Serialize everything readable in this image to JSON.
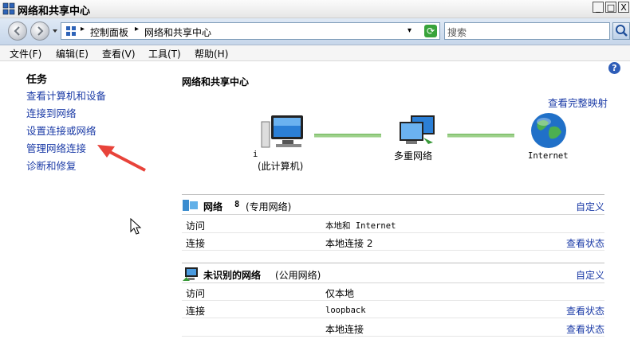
{
  "window": {
    "title": "网络和共享中心",
    "controls": {
      "minimize": "_",
      "maximize": "□",
      "close": "X"
    }
  },
  "address_bar": {
    "dropdown_arrow": "▾",
    "breadcrumbs": [
      "控制面板",
      "网络和共享中心"
    ],
    "search_placeholder": "搜索"
  },
  "menu": [
    "文件(F)",
    "编辑(E)",
    "查看(V)",
    "工具(T)",
    "帮助(H)"
  ],
  "help_symbol": "?",
  "tasks": {
    "title": "任务",
    "items": [
      "查看计算机和设备",
      "连接到网络",
      "设置连接或网络",
      "管理网络连接",
      "诊断和修复"
    ]
  },
  "main": {
    "title": "网络和共享中心",
    "full_map_link": "查看完整映射",
    "map": {
      "computer_label": "i",
      "computer_sublabel": "(此计算机)",
      "middle_label": "多重网络",
      "internet_label": "Internet"
    },
    "networks": [
      {
        "name": "网络",
        "name_suffix": "8",
        "type": "(专用网络)",
        "customize": "自定义",
        "rows": [
          {
            "label": "访问",
            "value": "本地和 Internet",
            "mono": false,
            "action": ""
          },
          {
            "label": "连接",
            "value": "本地连接 2",
            "mono": false,
            "action": "查看状态"
          }
        ]
      },
      {
        "name": "未识别的网络",
        "name_suffix": "",
        "type": "(公用网络)",
        "customize": "自定义",
        "rows": [
          {
            "label": "访问",
            "value": "仅本地",
            "mono": false,
            "action": ""
          },
          {
            "label": "连接",
            "value": "loopback",
            "mono": true,
            "action": "查看状态"
          },
          {
            "label": "",
            "value": "本地连接",
            "mono": false,
            "action": "查看状态"
          }
        ]
      }
    ]
  },
  "colors": {
    "link": "#1a3aa6",
    "annotation_arrow": "#e8433a",
    "connection_line": "#9dd08a"
  }
}
